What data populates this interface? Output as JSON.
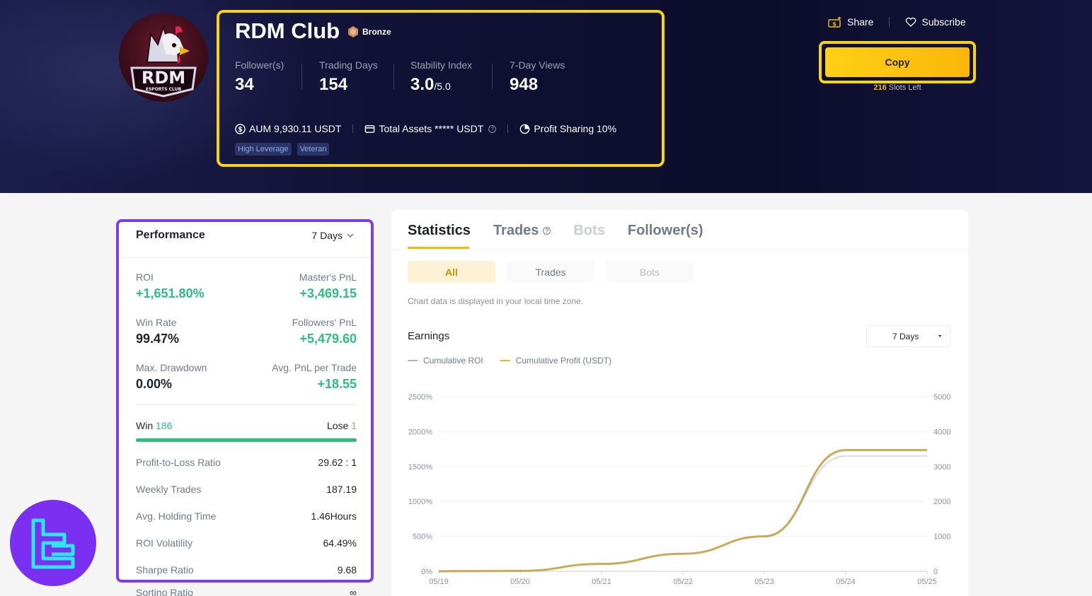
{
  "profile": {
    "name": "RDM Club",
    "badge": "Bronze",
    "logo_text": "RDM",
    "logo_subtext": "ESPORTS CLUB",
    "stats": [
      {
        "label": "Follower(s)",
        "value": "34",
        "suffix": ""
      },
      {
        "label": "Trading Days",
        "value": "154",
        "suffix": ""
      },
      {
        "label": "Stability Index",
        "value": "3.0",
        "suffix": "/5.0"
      },
      {
        "label": "7-Day Views",
        "value": "948",
        "suffix": ""
      }
    ],
    "aum": "AUM 9,930.11 USDT",
    "total_assets": "Total Assets ***** USDT",
    "profit_sharing": "Profit Sharing 10%",
    "tags": [
      "High Leverage",
      "Veteran"
    ]
  },
  "actions": {
    "share": "Share",
    "subscribe": "Subscribe",
    "copy": "Copy",
    "slots_count": "216",
    "slots_label": "Slots Left"
  },
  "performance": {
    "title": "Performance",
    "range": "7 Days",
    "metrics": [
      {
        "label": "ROI",
        "value": "+1,651.80%"
      },
      {
        "label": "Master's PnL",
        "value": "+3,469.15"
      },
      {
        "label": "Win Rate",
        "value": "99.47%"
      },
      {
        "label": "Followers' PnL",
        "value": "+5,479.60"
      },
      {
        "label": "Max. Drawdown",
        "value": "0.00%"
      },
      {
        "label": "Avg. PnL per Trade",
        "value": "+18.55"
      }
    ],
    "win_label": "Win",
    "win_count": "186",
    "lose_label": "Lose",
    "lose_count": "1",
    "win_fraction": 0.9947,
    "details": [
      {
        "label": "Profit-to-Loss Ratio",
        "value": "29.62 : 1"
      },
      {
        "label": "Weekly Trades",
        "value": "187.19"
      },
      {
        "label": "Avg. Holding Time",
        "value": "1.46Hours"
      },
      {
        "label": "ROI Volatility",
        "value": "64.49%"
      },
      {
        "label": "Sharpe Ratio",
        "value": "9.68"
      }
    ],
    "sortino_label": "Sortino Ratio",
    "sortino_value": "∞"
  },
  "main": {
    "tabs": [
      "Statistics",
      "Trades",
      "Bots",
      "Follower(s)"
    ],
    "subtabs": [
      "All",
      "Trades",
      "Bots"
    ],
    "note": "Chart data is displayed in your local time zone.",
    "earnings_title": "Earnings",
    "earnings_range": "7 Days"
  },
  "colors": {
    "accent": "#f0b90b",
    "positive": "#2ebd85",
    "negative": "#f6465d",
    "highlight_box": "#f5d414",
    "perf_box": "#7b3fe4",
    "roi_line": "#a9b6d8",
    "profit_line": "#c8aa5a"
  },
  "chart_data": {
    "type": "line",
    "x": [
      "05/19",
      "05/20",
      "05/21",
      "05/22",
      "05/23",
      "05/24",
      "05/25"
    ],
    "series": [
      {
        "name": "Cumulative ROI",
        "axis": "left",
        "values": [
          0,
          5,
          105,
          250,
          500,
          1650,
          1650
        ]
      },
      {
        "name": "Cumulative Profit (USDT)",
        "axis": "right",
        "values": [
          0,
          10,
          210,
          500,
          1000,
          3470,
          3470
        ]
      }
    ],
    "y_left_ticks": [
      "0%",
      "500%",
      "1000%",
      "1500%",
      "2000%",
      "2500%"
    ],
    "y_right_ticks": [
      "0",
      "1000",
      "2000",
      "3000",
      "4000",
      "5000"
    ],
    "y_left_range": [
      0,
      2500
    ],
    "y_right_range": [
      0,
      5000
    ],
    "grid": true
  }
}
